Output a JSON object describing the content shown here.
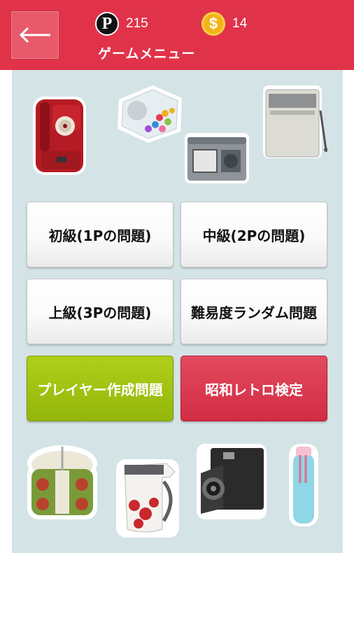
{
  "header": {
    "back_icon": "left-arrow-icon",
    "title": "ゲームメニュー",
    "points_icon": "P",
    "points_value": "215",
    "coins_icon": "$",
    "coins_value": "14",
    "background_color": "#e0334a"
  },
  "menu": {
    "beginner_label": "初級(1Pの問題)",
    "intermediate_label": "中級(2Pの問題)",
    "advanced_label": "上級(3Pの問題)",
    "random_label": "難易度ランダム問題",
    "player_created_label": "プレイヤー作成問題",
    "showa_retro_label": "昭和レトロ検定",
    "player_created_color": "#9cbd0f",
    "showa_retro_color": "#d93048"
  },
  "decorations": {
    "top": [
      "red-payphone-icon",
      "candy-jar-icon",
      "radio-cassette-icon",
      "washing-machine-icon"
    ],
    "bottom": [
      "rice-cooker-icon",
      "flower-thermos-pot-icon",
      "folding-camera-icon",
      "water-bottle-icon"
    ]
  }
}
